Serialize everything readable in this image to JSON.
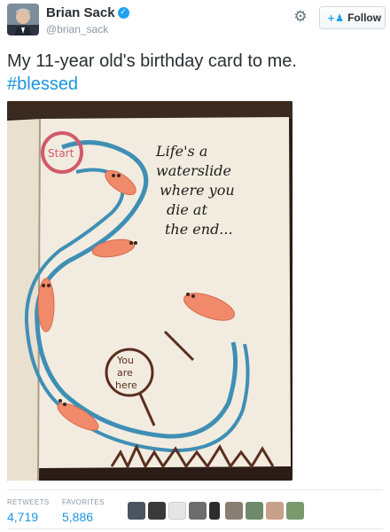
{
  "user": {
    "display_name": "Brian Sack",
    "handle": "@brian_sack",
    "verified_icon": "verified-badge-icon",
    "avatar_icon": "profile-photo"
  },
  "actions": {
    "settings_icon": "gear-icon",
    "follow_label": "Follow",
    "follow_icon": "add-person-icon"
  },
  "tweet": {
    "text": "My 11-year old's birthday card to me.",
    "hashtag": "#blessed"
  },
  "card": {
    "start_label": "Start",
    "caption_lines": [
      "Life's a",
      "waterslide",
      "where you",
      "die at",
      "the end..."
    ],
    "marker_lines": [
      "You",
      "are",
      "here"
    ]
  },
  "stats": {
    "retweets_label": "RETWEETS",
    "retweets_value": "4,719",
    "favorites_label": "FAVORITES",
    "favorites_value": "5,886",
    "favoriter_avatar_count": 9
  },
  "colors": {
    "link": "#1b95e0",
    "verified": "#1da1f2",
    "muted": "#8899a6"
  }
}
